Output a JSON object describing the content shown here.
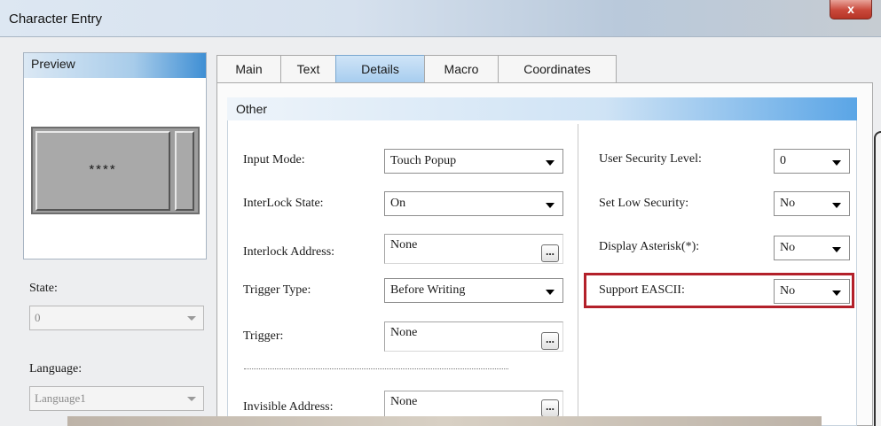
{
  "window": {
    "title": "Character Entry",
    "close_glyph": "x"
  },
  "preview": {
    "header": "Preview",
    "display_text": "****"
  },
  "sidebar": {
    "state_label": "State:",
    "state_value": "0",
    "language_label": "Language:",
    "language_value": "Language1"
  },
  "tabs": [
    "Main",
    "Text",
    "Details",
    "Macro",
    "Coordinates"
  ],
  "active_tab": "Details",
  "group": {
    "title": "Other"
  },
  "left_fields": {
    "input_mode_label": "Input Mode:",
    "input_mode_value": "Touch Popup",
    "interlock_state_label": "InterLock State:",
    "interlock_state_value": "On",
    "interlock_address_label": "Interlock Address:",
    "interlock_address_value": "None",
    "trigger_type_label": "Trigger Type:",
    "trigger_type_value": "Before Writing",
    "trigger_label": "Trigger:",
    "trigger_value": "None",
    "invisible_address_label": "Invisible Address:",
    "invisible_address_value": "None",
    "browse_glyph": "..."
  },
  "right_fields": {
    "user_security_label": "User Security Level:",
    "user_security_value": "0",
    "low_security_label": "Set Low Security:",
    "low_security_value": "No",
    "display_asterisk_label": "Display Asterisk(*):",
    "display_asterisk_value": "No",
    "support_eascii_label": "Support EASCII:",
    "support_eascii_value": "No"
  },
  "colors": {
    "highlight": "#b3202a",
    "active_tab": "#a7cdef",
    "close_button": "#c9483a"
  }
}
